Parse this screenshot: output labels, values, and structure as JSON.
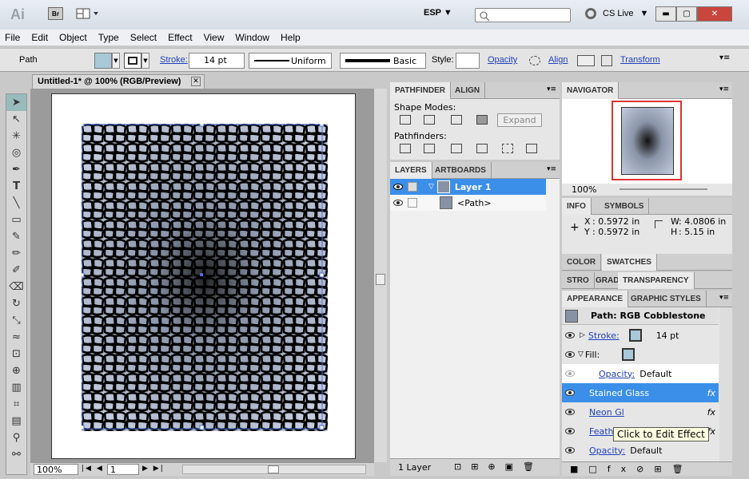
{
  "window": {
    "app_logo": "Ai",
    "bridge_label": "Br",
    "workspace": "ESP",
    "cs_live": "CS Live"
  },
  "menu": [
    "File",
    "Edit",
    "Object",
    "Type",
    "Select",
    "Effect",
    "View",
    "Window",
    "Help"
  ],
  "control": {
    "selection_label": "Path",
    "stroke_label": "Stroke:",
    "stroke_weight": "14 pt",
    "profile": "Uniform",
    "brush": "Basic",
    "style_label": "Style:",
    "opacity_label": "Opacity",
    "align_label": "Align",
    "transform_label": "Transform"
  },
  "document": {
    "tab_title": "Untitled-1* @ 100% (RGB/Preview)",
    "zoom": "100%",
    "artboard_num": "1"
  },
  "pathfinder": {
    "tabs": [
      "PATHFINDER",
      "ALIGN"
    ],
    "shape_modes_label": "Shape Modes:",
    "pathfinders_label": "Pathfinders:",
    "expand_label": "Expand"
  },
  "layers": {
    "tabs": [
      "LAYERS",
      "ARTBOARDS"
    ],
    "layer_name": "Layer 1",
    "path_name": "<Path>",
    "footer": "1 Layer"
  },
  "navigator": {
    "tab": "NAVIGATOR",
    "zoom": "100%"
  },
  "info": {
    "tabs": [
      "INFO",
      "SYMBOLS"
    ],
    "x": ": 0.5972 in",
    "y": ": 0.5972 in",
    "w": ": 4.0806 in",
    "h": ": 5.15 in"
  },
  "color": {
    "tabs": [
      "COLOR",
      "SWATCHES"
    ]
  },
  "stroke_row": {
    "tabs": [
      "STRO",
      "GRAD",
      "TRANSPARENCY"
    ]
  },
  "appearance": {
    "tabs": [
      "APPEARANCE",
      "GRAPHIC STYLES"
    ],
    "title": "Path: RGB Cobblestone",
    "stroke_label": "Stroke:",
    "stroke_value": "14 pt",
    "fill_label": "Fill:",
    "opacity_label": "Opacity:",
    "opacity_value": "Default",
    "effects": [
      "Stained Glass",
      "Neon Gl",
      "Feather"
    ],
    "tooltip": "Click to Edit Effect",
    "bottom_opacity_label": "Opacity:",
    "bottom_opacity_value": "Default"
  },
  "colors": {
    "accent": "#3b8fe8",
    "link": "#1f3fbf",
    "fill_swatch": "#a9c8d8"
  }
}
